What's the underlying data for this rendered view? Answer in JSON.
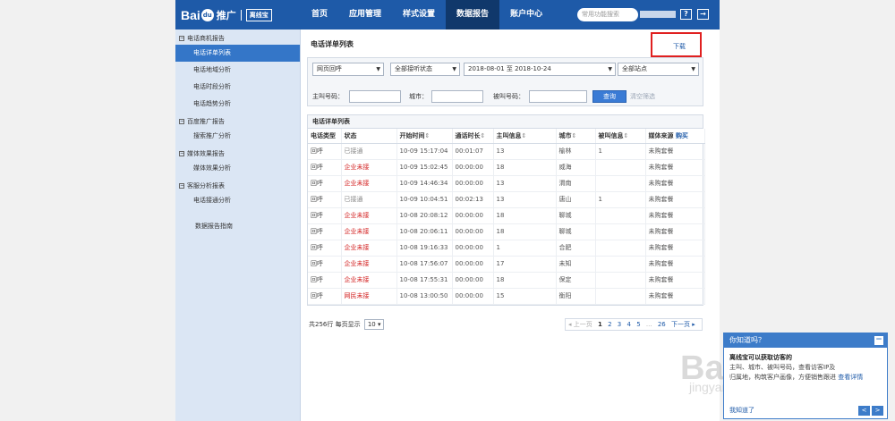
{
  "nav": {
    "logo_bai": "Bai",
    "logo_du": "du",
    "logo_tuiguang": "推广",
    "logo_product": "离线宝",
    "tabs": [
      "首页",
      "应用管理",
      "样式设置",
      "数据报告",
      "账户中心"
    ],
    "active_tab": "数据报告",
    "search_placeholder": "常用功能搜索",
    "help_icon": "?",
    "logout_icon": "→"
  },
  "sidebar": {
    "groups": [
      {
        "label": "电话商机报告",
        "items": [
          "电话详单列表",
          "电话地域分析",
          "电话时段分析",
          "电话趋势分析"
        ]
      },
      {
        "label": "百度推广报告",
        "items": [
          "搜索推广分析"
        ]
      },
      {
        "label": "媒体效果报告",
        "items": [
          "媒体效果分析"
        ]
      },
      {
        "label": "客服分析报表",
        "items": [
          "电话接通分析"
        ]
      }
    ],
    "active_item": "电话详单列表",
    "extra": "数据报告指南"
  },
  "main": {
    "title": "电话详单列表",
    "download": "下载",
    "filters": {
      "type_select": "网页回呼",
      "status_select": "全部接听状态",
      "date_range": "2018-08-01 至 2018-10-24",
      "site_select": "全部站点",
      "caller_label": "主叫号码：",
      "city_label": "城市：",
      "callee_label": "被叫号码：",
      "query_button": "查询",
      "clear_link": "清空筛选"
    },
    "table": {
      "title": "电话详单列表",
      "headers": [
        "电话类型",
        "状态",
        "开始时间",
        "通话时长",
        "主叫信息",
        "城市",
        "被叫信息",
        "媒体来源",
        "购买"
      ],
      "rows": [
        {
          "type": "回呼",
          "status": "已接通",
          "time": "10-09 15:17:04",
          "duration": "00:01:07",
          "caller": "13",
          "city": "榆林",
          "callee": "1",
          "source": "未购套餐"
        },
        {
          "type": "回呼",
          "status": "企业未接",
          "time": "10-09 15:02:45",
          "duration": "00:00:00",
          "caller": "18",
          "city": "威海",
          "callee": "",
          "source": "未购套餐"
        },
        {
          "type": "回呼",
          "status": "企业未接",
          "time": "10-09 14:46:34",
          "duration": "00:00:00",
          "caller": "13",
          "city": "渭南",
          "callee": "",
          "source": "未购套餐"
        },
        {
          "type": "回呼",
          "status": "已接通",
          "time": "10-09 10:04:51",
          "duration": "00:02:13",
          "caller": "13",
          "city": "唐山",
          "callee": "1",
          "source": "未购套餐"
        },
        {
          "type": "回呼",
          "status": "企业未接",
          "time": "10-08 20:08:12",
          "duration": "00:00:00",
          "caller": "18",
          "city": "聊城",
          "callee": "",
          "source": "未购套餐"
        },
        {
          "type": "回呼",
          "status": "企业未接",
          "time": "10-08 20:06:11",
          "duration": "00:00:00",
          "caller": "18",
          "city": "聊城",
          "callee": "",
          "source": "未购套餐"
        },
        {
          "type": "回呼",
          "status": "企业未接",
          "time": "10-08 19:16:33",
          "duration": "00:00:00",
          "caller": "1",
          "city": "合肥",
          "callee": "",
          "source": "未购套餐"
        },
        {
          "type": "回呼",
          "status": "企业未接",
          "time": "10-08 17:56:07",
          "duration": "00:00:00",
          "caller": "17",
          "city": "未知",
          "callee": "",
          "source": "未购套餐"
        },
        {
          "type": "回呼",
          "status": "企业未接",
          "time": "10-08 17:55:31",
          "duration": "00:00:00",
          "caller": "18",
          "city": "保定",
          "callee": "",
          "source": "未购套餐"
        },
        {
          "type": "回呼",
          "status": "网民未接",
          "time": "10-08 13:00:50",
          "duration": "00:00:00",
          "caller": "15",
          "city": "衡阳",
          "callee": "",
          "source": "未购套餐"
        }
      ]
    },
    "footer": {
      "total": "共256行 每页显示",
      "page_size": "10 ▾"
    },
    "pager": {
      "prev": "◂ 上一页",
      "pages": [
        "1",
        "2",
        "3",
        "4",
        "5"
      ],
      "ellipsis": "...",
      "last": "26",
      "next": "下一页 ▸"
    }
  },
  "tip": {
    "title": "你知道吗？",
    "close": "−",
    "line1": "离线宝可以获取访客的",
    "line2": "主叫、城市、被叫号码，查看访客IP及",
    "line3": "归属地，构筑客户画像，方便销售跟进",
    "more": "查看详情",
    "foot": "我知道了",
    "prev": "<",
    "next": ">"
  },
  "watermark": {
    "big": "Baidu经验",
    "small": "jingyan.baidu.com"
  }
}
